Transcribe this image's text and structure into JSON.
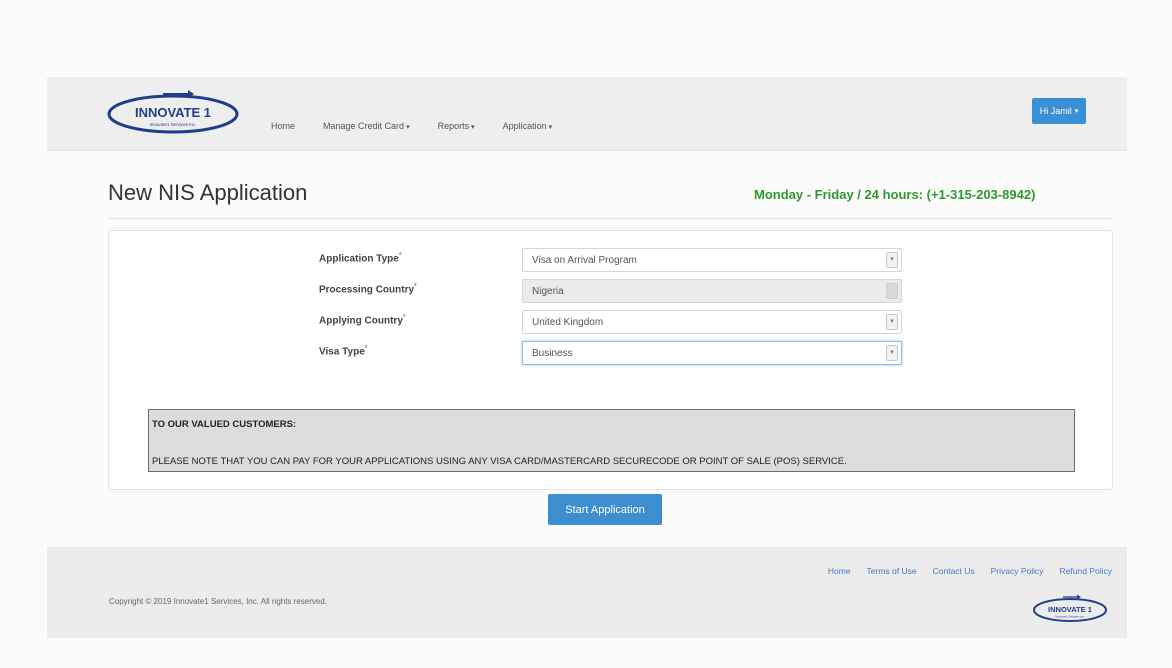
{
  "header": {
    "logo": {
      "title": "INNOVATE 1",
      "subtitle": "Innovate1 Services Inc."
    },
    "nav": [
      {
        "label": "Home",
        "dropdown": false
      },
      {
        "label": "Manage Credit Card",
        "dropdown": true
      },
      {
        "label": "Reports",
        "dropdown": true
      },
      {
        "label": "Application",
        "dropdown": true
      }
    ],
    "user_menu": "Hi Jamil",
    "accent_color": "#3b8fd4"
  },
  "page": {
    "title": "New NIS Application",
    "support_hours": "Monday - Friday / 24 hours: (+1-315-203-8942)",
    "support_color": "#2e9a2e"
  },
  "form": {
    "fields": [
      {
        "label": "Application Type",
        "required_mark": "*",
        "value": "Visa on Arrival Program",
        "state": "normal"
      },
      {
        "label": "Processing Country",
        "required_mark": "*",
        "value": "Nigeria",
        "state": "disabled"
      },
      {
        "label": "Applying Country",
        "required_mark": "*",
        "value": "United Kingdom",
        "state": "normal"
      },
      {
        "label": "Visa Type",
        "required_mark": "*",
        "value": "Business",
        "state": "focused"
      }
    ]
  },
  "notice": {
    "title": "TO OUR VALUED CUSTOMERS:",
    "body": "PLEASE NOTE THAT YOU CAN PAY FOR YOUR APPLICATIONS USING ANY VISA CARD/MASTERCARD SECURECODE OR POINT OF SALE (POS) SERVICE."
  },
  "actions": {
    "start_label": "Start Application"
  },
  "footer": {
    "links": [
      "Home",
      "Terms of Use",
      "Contact Us",
      "Privacy Policy",
      "Refund Policy"
    ],
    "copyright": "Copyright © 2019 Innovate1 Services, Inc. All rights reserved.",
    "logo": {
      "title": "INNOVATE 1",
      "subtitle": "Innovate1 Services Inc."
    }
  }
}
